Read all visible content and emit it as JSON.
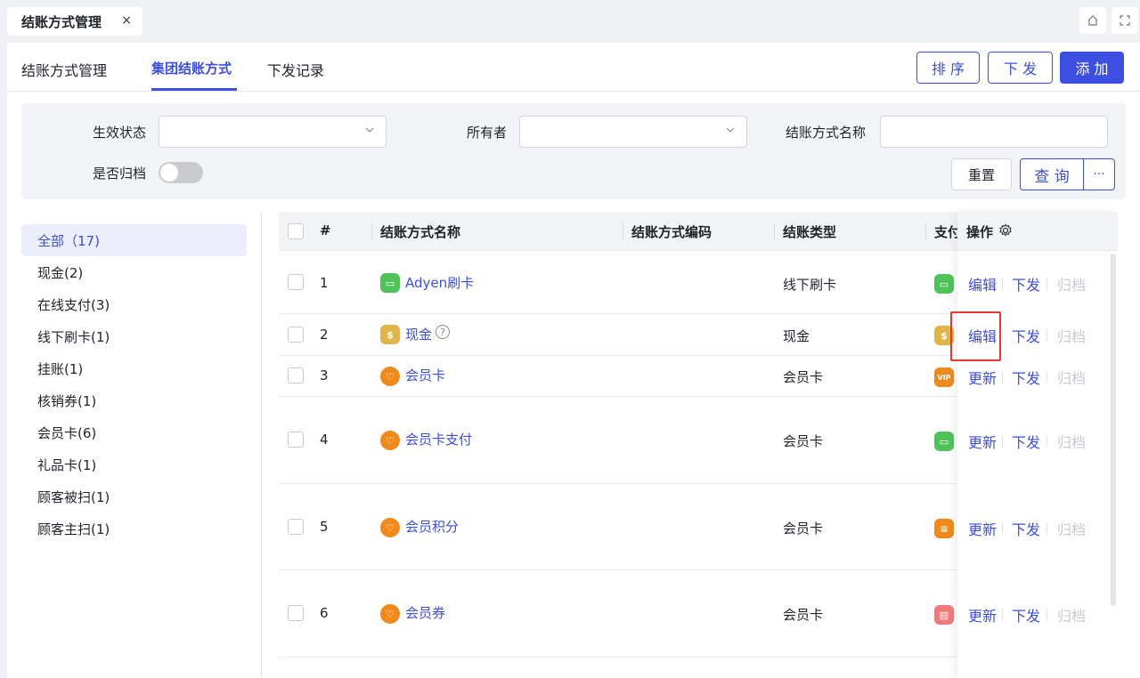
{
  "window": {
    "tab_title": "结账方式管理",
    "tab_close": "×"
  },
  "subnav": {
    "tabs": [
      "结账方式管理",
      "集团结账方式",
      "下发记录"
    ],
    "active_tab": "集团结账方式",
    "buttons": {
      "sort": "排 序",
      "distribute": "下 发",
      "add": "添 加"
    }
  },
  "filters": {
    "status_label": "生效状态",
    "owner_label": "所有者",
    "name_label": "结账方式名称",
    "archived_label": "是否归档",
    "reset": "重置",
    "query": "查 询",
    "more": "···"
  },
  "sidebar": {
    "items": [
      {
        "label": "全部（17)"
      },
      {
        "label": "现金(2)"
      },
      {
        "label": "在线支付(3)"
      },
      {
        "label": "线下刷卡(1)"
      },
      {
        "label": "挂账(1)"
      },
      {
        "label": "核销券(1)"
      },
      {
        "label": "会员卡(6)"
      },
      {
        "label": "礼品卡(1)"
      },
      {
        "label": "顾客被扫(1)"
      },
      {
        "label": "顾客主扫(1)"
      }
    ]
  },
  "table": {
    "headers": {
      "index": "#",
      "name": "结账方式名称",
      "code": "结账方式编码",
      "type": "结账类型",
      "pay": "支付",
      "actions": "操作"
    },
    "rows": [
      {
        "index": "1",
        "name": "Adyen刷卡",
        "type": "线下刷卡",
        "icon": "card-icon",
        "a1": "编辑",
        "a2": "下发",
        "a3": "归档"
      },
      {
        "index": "2",
        "name": "现金",
        "type": "现金",
        "icon": "money-bag-icon",
        "a1": "编辑",
        "a2": "下发",
        "a3": "归档"
      },
      {
        "index": "3",
        "name": "会员卡",
        "type": "会员卡",
        "icon": "member-icon",
        "a1": "更新",
        "a2": "下发",
        "a3": "归档"
      },
      {
        "index": "4",
        "name": "会员卡支付",
        "type": "会员卡",
        "icon": "member-icon",
        "a1": "更新",
        "a2": "下发",
        "a3": "归档"
      },
      {
        "index": "5",
        "name": "会员积分",
        "type": "会员卡",
        "icon": "member-icon",
        "a1": "更新",
        "a2": "下发",
        "a3": "归档"
      },
      {
        "index": "6",
        "name": "会员券",
        "type": "会员卡",
        "icon": "member-icon",
        "a1": "更新",
        "a2": "下发",
        "a3": "归档"
      }
    ]
  },
  "colors": {
    "accent": "#3d4fe0",
    "highlight": "#e53935"
  }
}
